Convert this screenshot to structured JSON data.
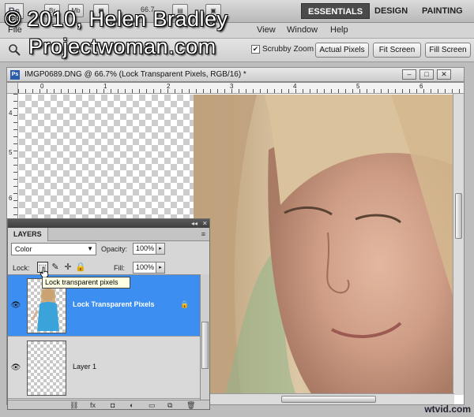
{
  "watermark": {
    "line1": "© 2010, Helen Bradley",
    "line2": "Projectwoman.com"
  },
  "appbar": {
    "logo": "Ps",
    "icons": [
      {
        "name": "bridge-icon",
        "label": "Br"
      },
      {
        "name": "minibridge-icon",
        "label": "Mb"
      },
      {
        "name": "view-extras-icon",
        "label": "▦"
      },
      {
        "name": "arrange-icon",
        "label": "▤"
      },
      {
        "name": "screen-mode-icon",
        "label": "▣"
      }
    ],
    "zoom": "66.7",
    "workspaces": [
      "ESSENTIALS",
      "DESIGN",
      "PAINTING"
    ],
    "active_workspace": "ESSENTIALS"
  },
  "menubar": {
    "items": [
      "File",
      "View",
      "Window",
      "Help"
    ]
  },
  "options": {
    "scrubby_zoom": "Scrubby Zoom",
    "buttons": [
      "Actual Pixels",
      "Fit Screen",
      "Fill Screen"
    ]
  },
  "document": {
    "title": "IMGP0689.DNG @ 66.7% (Lock Transparent Pixels, RGB/16) *",
    "icon_label": "Ps",
    "controls": [
      "–",
      "□",
      "✕"
    ],
    "ruler_top": [
      "0",
      "1",
      "2",
      "3",
      "4",
      "5",
      "6"
    ],
    "ruler_left": [
      "4",
      "5",
      "6"
    ]
  },
  "layers": {
    "tab": "LAYERS",
    "panel_menu": "≡",
    "collapse": "◂◂",
    "close": "✕",
    "blend_mode": "Color",
    "opacity_label": "Opacity:",
    "opacity": "100%",
    "lock_label": "Lock:",
    "fill_label": "Fill:",
    "fill": "100%",
    "items": [
      {
        "name": "Lock Transparent Pixels",
        "selected": true
      },
      {
        "name": "Layer 1",
        "selected": false
      }
    ],
    "footer_icons": [
      "⛓",
      "fx",
      "◘",
      "◐",
      "▭",
      "⧉",
      "🗑"
    ]
  },
  "tooltip": "Lock transparent pixels",
  "site_watermark": "wtvid.com",
  "colors": {
    "selection": "#3c8ef0",
    "workspace_active": "#4a4a4a"
  }
}
